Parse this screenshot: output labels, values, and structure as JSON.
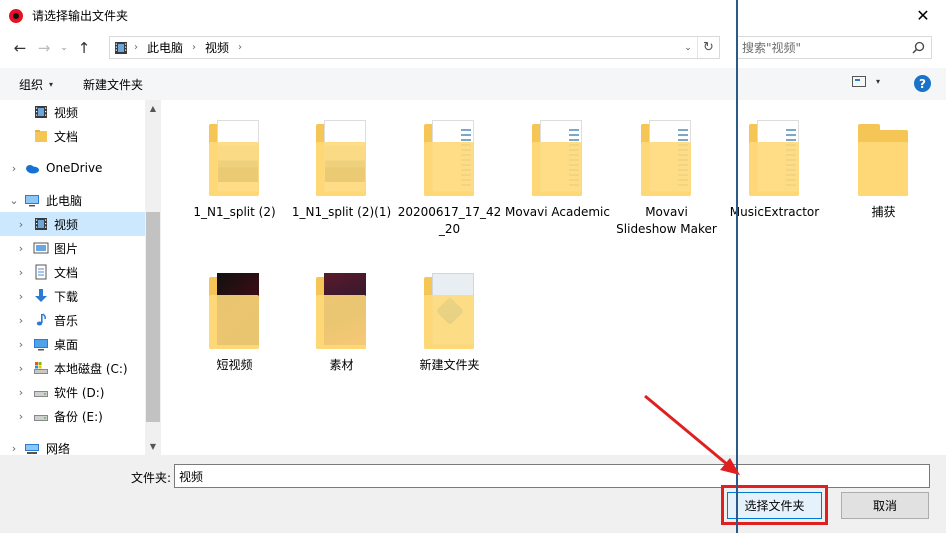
{
  "window": {
    "title": "请选择输出文件夹",
    "close_glyph": "✕"
  },
  "nav": {
    "back": "←",
    "forward": "→",
    "recent": "⌄",
    "up": "↑",
    "breadcrumbs": [
      "此电脑",
      "视频"
    ],
    "breadcrumb_sep": "›",
    "dropdown": "⌄",
    "refresh": "↻",
    "search_placeholder": "搜索\"视频\""
  },
  "toolbar": {
    "organize_label": "组织",
    "new_folder_label": "新建文件夹",
    "caret": "▾",
    "help_label": "?"
  },
  "sidebar": {
    "items": [
      {
        "label": "视频",
        "icon": "video-folder-icon",
        "indent": 1,
        "chevron": ""
      },
      {
        "label": "文档",
        "icon": "folder-icon",
        "indent": 1,
        "chevron": ""
      },
      {
        "label": "OneDrive",
        "icon": "onedrive-icon",
        "indent": 0,
        "chevron": "›"
      },
      {
        "label": "此电脑",
        "icon": "pc-icon",
        "indent": 0,
        "chevron": "⌄"
      },
      {
        "label": "视频",
        "icon": "video-folder-icon",
        "indent": 1,
        "chevron": "›",
        "selected": true
      },
      {
        "label": "图片",
        "icon": "pictures-icon",
        "indent": 1,
        "chevron": "›"
      },
      {
        "label": "文档",
        "icon": "documents-icon",
        "indent": 1,
        "chevron": "›"
      },
      {
        "label": "下载",
        "icon": "download-icon",
        "indent": 1,
        "chevron": "›"
      },
      {
        "label": "音乐",
        "icon": "music-icon",
        "indent": 1,
        "chevron": "›"
      },
      {
        "label": "桌面",
        "icon": "desktop-icon",
        "indent": 1,
        "chevron": "›"
      },
      {
        "label": "本地磁盘 (C:)",
        "icon": "system-drive-icon",
        "indent": 1,
        "chevron": "›"
      },
      {
        "label": "软件 (D:)",
        "icon": "drive-icon",
        "indent": 1,
        "chevron": "›"
      },
      {
        "label": "备份 (E:)",
        "icon": "drive-icon",
        "indent": 1,
        "chevron": "›"
      },
      {
        "label": "网络",
        "icon": "network-icon",
        "indent": 0,
        "chevron": "›"
      }
    ],
    "scroll_up": "▲",
    "scroll_down": "▼"
  },
  "folders": [
    {
      "label": "1_N1_split (2)",
      "thumb": "mountain"
    },
    {
      "label": "1_N1_split (2)(1)",
      "thumb": "mountain"
    },
    {
      "label": "20200617_17_42_20",
      "thumb": "doc"
    },
    {
      "label": "Movavi Academic",
      "thumb": "doc"
    },
    {
      "label": "Movavi Slideshow Maker",
      "thumb": "doc"
    },
    {
      "label": "MusicExtractor",
      "thumb": "doc"
    },
    {
      "label": "捕获",
      "thumb": "empty"
    },
    {
      "label": "短视频",
      "thumb": "dark"
    },
    {
      "label": "素材",
      "thumb": "red"
    },
    {
      "label": "新建文件夹",
      "thumb": "mp4"
    }
  ],
  "bottom": {
    "folder_label": "文件夹:",
    "folder_value": "视频",
    "select_button": "选择文件夹",
    "cancel_button": "取消"
  }
}
